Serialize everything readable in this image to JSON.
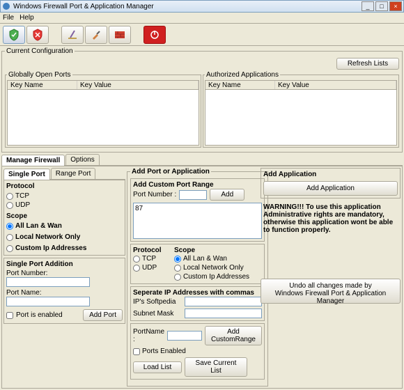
{
  "window": {
    "title": "Windows Firewall Port & Application Manager"
  },
  "menu": {
    "file": "File",
    "help": "Help"
  },
  "cfg": {
    "title": "Current Configuration",
    "refresh": "Refresh Lists",
    "openPorts": {
      "title": "Globally Open Ports",
      "col1": "Key Name",
      "col2": "Key Value"
    },
    "authApps": {
      "title": "Authorized Applications",
      "col1": "Key Name",
      "col2": "Key Value"
    }
  },
  "tabs": {
    "manage": "Manage Firewall",
    "options": "Options"
  },
  "subtabs": {
    "single": "Single Port",
    "range": "Range Port"
  },
  "left": {
    "protocol": "Protocol",
    "tcp": "TCP",
    "udp": "UDP",
    "scope": "Scope",
    "scope1": "All Lan & Wan",
    "scope2": "Local Network Only",
    "scope3": "Custom Ip Addresses",
    "spa": "Single Port Addition",
    "portNum": "Port Number:",
    "portName": "Port Name:",
    "portEnabled": "Port is enabled",
    "addPort": "Add Port"
  },
  "mid": {
    "title": "Add Port or Application",
    "acpr": "Add Custom Port Range",
    "portNumber": "Port Number :",
    "add": "Add",
    "listValue": "87",
    "protocol": "Protocol",
    "tcp": "TCP",
    "udp": "UDP",
    "scope": "Scope",
    "scope1": "All Lan & Wan",
    "scope2": "Local Network Only",
    "scope3": "Custom Ip Addresses",
    "sepIp": "Seperate IP Addresses with commas",
    "ips": "IP's  Softpedia",
    "subnet": "Subnet Mask",
    "portName": "PortName :",
    "addRange": "Add CustomRange",
    "portsEnabled": "Ports Enabled",
    "loadList": "Load List",
    "saveList": "Save Current List"
  },
  "right": {
    "addApp": "Add Application",
    "addAppBtn": "Add Application",
    "warn": "WARNING!!! To use this application Administrative rights are mandatory, otherwise this application wont be able to function properly.",
    "undo": "Undo all changes made by\nWindows Firewall Port & Application Manager"
  }
}
